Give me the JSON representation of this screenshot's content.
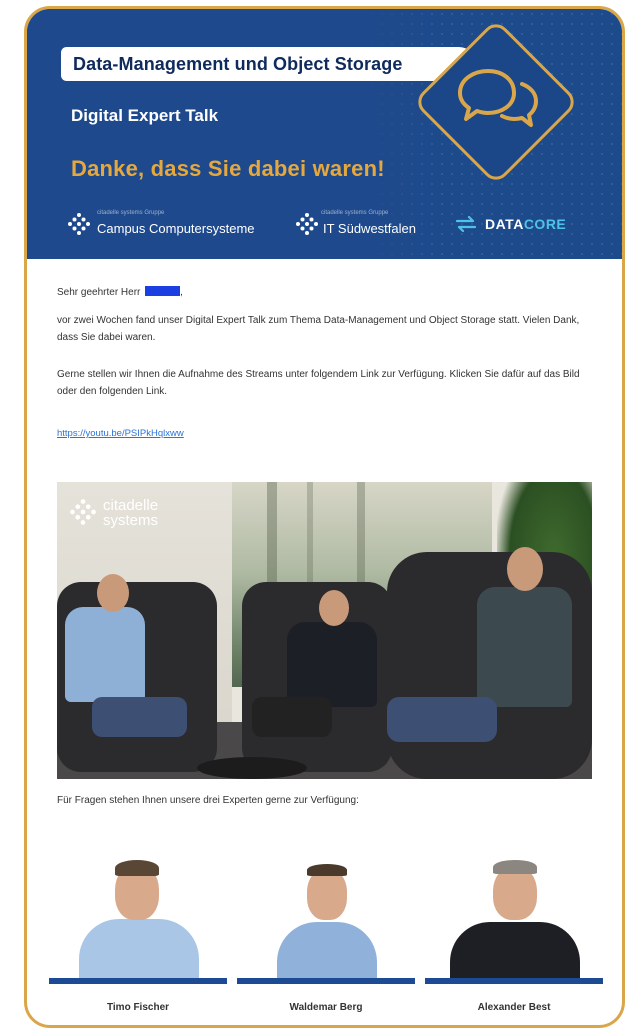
{
  "header": {
    "title": "Data-Management und Object Storage",
    "subtitle": "Digital Expert Talk",
    "headline": "Danke, dass Sie dabei waren!",
    "chat_icon": "speech-bubbles-icon",
    "logos": [
      {
        "group": "citadelle systems Gruppe",
        "name": "Campus Computersysteme"
      },
      {
        "group": "citadelle systems Gruppe",
        "name": "IT Südwestfalen"
      },
      {
        "name_a": "DATA",
        "name_b": "CORE"
      }
    ]
  },
  "body": {
    "greeting": "Sehr geehrter Herr",
    "greeting_suffix": ",",
    "paragraph1": "vor zwei Wochen fand unser Digital Expert Talk zum Thema Data-Management und Object Storage statt. Vielen Dank, dass Sie dabei waren.",
    "paragraph2": "Gerne stellen wir Ihnen die Aufnahme des Streams unter folgendem Link zur Verfügung. Klicken Sie dafür auf das Bild oder den folgenden Link.",
    "link": "https://youtu.be/PSIPkHqlxww",
    "video_logo": "citadelle systems",
    "experts_intro": "Für Fragen stehen Ihnen unsere drei Experten gerne zur Verfügung:"
  },
  "experts": [
    {
      "name": "Timo Fischer"
    },
    {
      "name": "Waldemar Berg"
    },
    {
      "name": "Alexander Best"
    }
  ],
  "colors": {
    "banner": "#1e4a8d",
    "accent": "#d9a74a",
    "link": "#2a73d9",
    "bar": "#1c4a93"
  }
}
